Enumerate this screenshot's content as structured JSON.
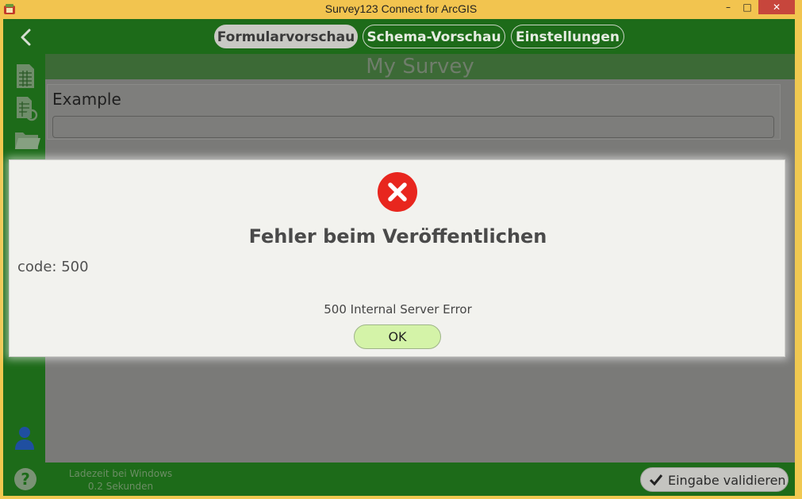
{
  "window": {
    "title": "Survey123 Connect for ArcGIS",
    "controls": {
      "minimize": "–",
      "maximize": "□",
      "close": "✕"
    }
  },
  "tabs": [
    {
      "label": "Formularvorschau",
      "active": true
    },
    {
      "label": "Schema-Vorschau",
      "active": false
    },
    {
      "label": "Einstellungen",
      "active": false
    }
  ],
  "sidebar": {
    "icons": [
      "spreadsheet-icon",
      "spreadsheet-refresh-icon",
      "folder-icon",
      "user-icon",
      "help-icon"
    ],
    "help_glyph": "?"
  },
  "survey": {
    "title": "My Survey",
    "question_label": "Example",
    "question_value": ""
  },
  "footer": {
    "line1": "Ladezeit bei Windows",
    "line2": "0.2 Sekunden",
    "validate_label": "Eingabe validieren"
  },
  "dialog": {
    "title": "Fehler beim Veröffentlichen",
    "code": "code: 500",
    "detail": "500 Internal Server Error",
    "ok_label": "OK"
  },
  "colors": {
    "accent_green": "#1d6b19",
    "title_bar": "#f2c44f",
    "error_red": "#e8261e",
    "ok_button": "#d4f3a8"
  }
}
